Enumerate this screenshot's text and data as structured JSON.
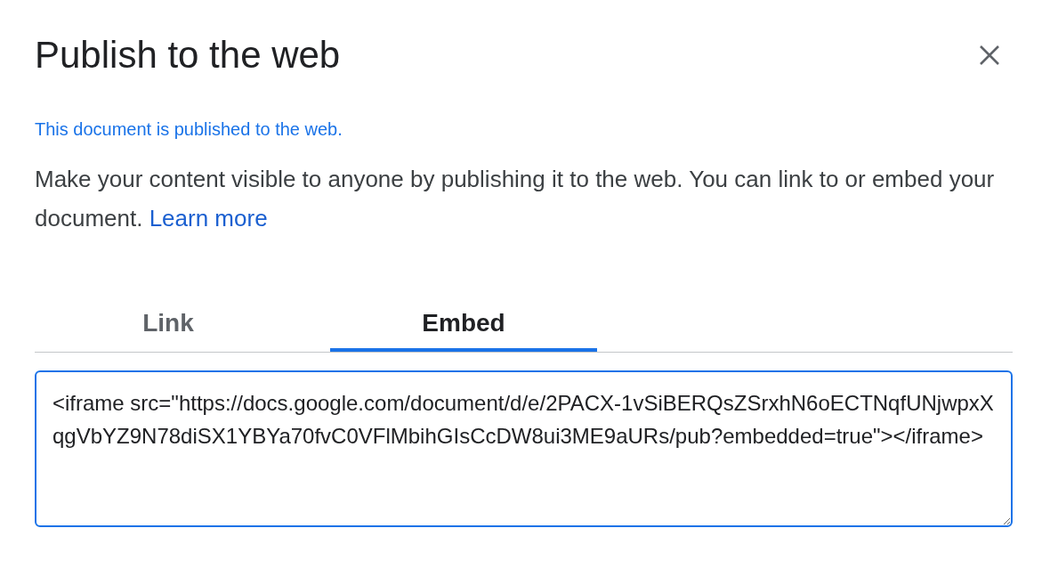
{
  "dialog": {
    "title": "Publish to the web"
  },
  "status": "This document is published to the web.",
  "description": {
    "text": "Make your content visible to anyone by publishing it to the web. You can link to or embed your document.",
    "link": "Learn more"
  },
  "tabs": [
    {
      "label": "Link",
      "selected": false
    },
    {
      "label": "Embed",
      "selected": true
    }
  ],
  "embed_code": {
    "value": "<iframe src=\"https://docs.google.com/document/d/e/2PACX-1vSiBERQsZSrxhN6oECTNqfUNjwpxXqgVbYZ9N78diSX1YBYa70fvC0VFlMbihGIsCcDW8ui3ME9aURs/pub?embedded=true\"></iframe>"
  }
}
